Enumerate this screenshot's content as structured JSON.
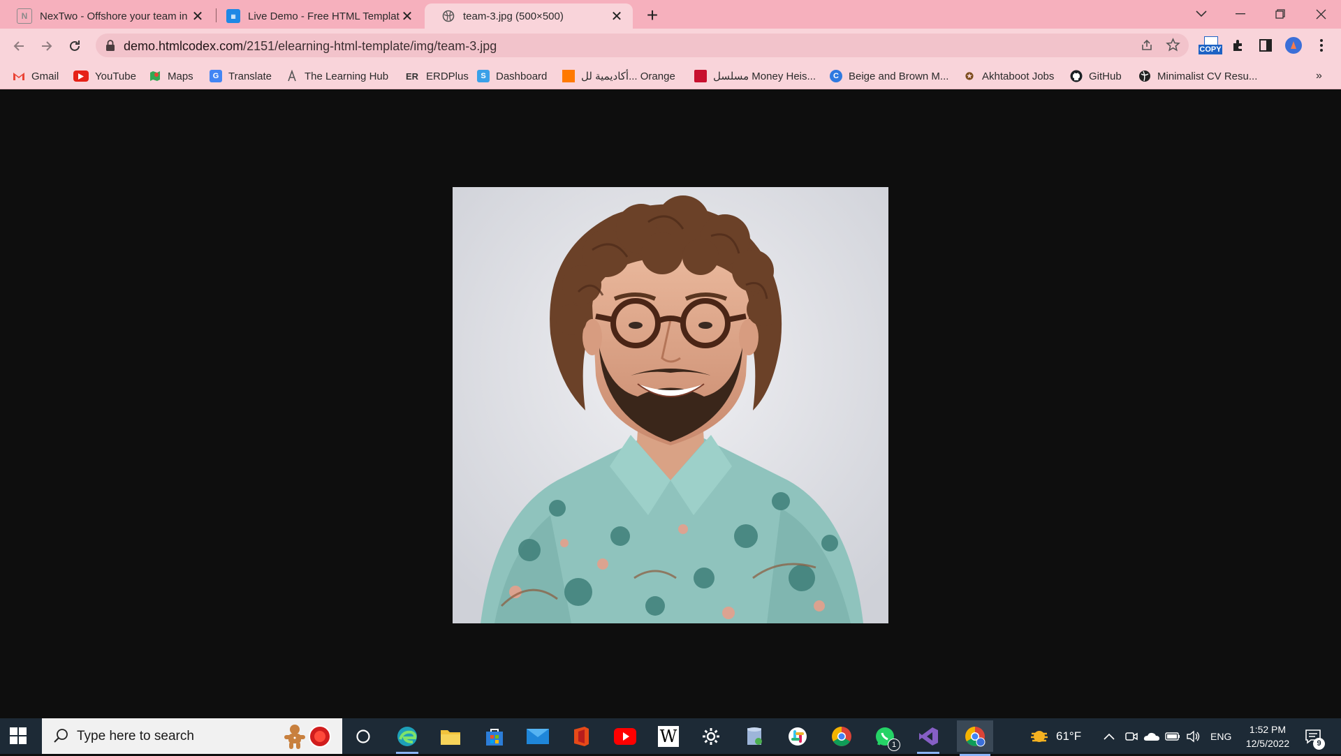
{
  "browser": {
    "tabs": [
      {
        "title": "NexTwo - Offshore your team in",
        "favicon": "nextwo-icon"
      },
      {
        "title": "Live Demo - Free HTML Template",
        "favicon": "htmlcodex-icon"
      },
      {
        "title": "team-3.jpg (500×500)",
        "favicon": "globe-icon",
        "active": true
      }
    ],
    "new_tab_label": "+",
    "window_controls": {
      "list": "⌄",
      "minimize": "—",
      "restore": "❐",
      "close": "✕"
    }
  },
  "toolbar": {
    "back": "←",
    "forward": "→",
    "reload": "↻",
    "url_host": "demo.htmlcodex.com",
    "url_path": "/2151/elearning-html-template/img/team-3.jpg",
    "copy_extension_label": "COPY"
  },
  "bookmarks": [
    {
      "label": "Gmail",
      "icon": "gmail-icon"
    },
    {
      "label": "YouTube",
      "icon": "youtube-icon"
    },
    {
      "label": "Maps",
      "icon": "maps-icon"
    },
    {
      "label": "Translate",
      "icon": "translate-icon"
    },
    {
      "label": "The Learning Hub",
      "icon": "learning-hub-icon"
    },
    {
      "label": "ERDPlus",
      "icon": "erdplus-icon"
    },
    {
      "label": "Dashboard",
      "icon": "dashboard-icon"
    },
    {
      "label": "أكاديمية لل... Orange",
      "icon": "orange-icon"
    },
    {
      "label": "مسلسل Money Heis...",
      "icon": "money-heist-icon"
    },
    {
      "label": "Beige and Brown M...",
      "icon": "canva-icon"
    },
    {
      "label": "Akhtaboot Jobs",
      "icon": "akhtaboot-icon"
    },
    {
      "label": "GitHub",
      "icon": "github-icon"
    },
    {
      "label": "Minimalist CV Resu...",
      "icon": "globe-icon"
    }
  ],
  "bookmarks_overflow": "»",
  "image_view": {
    "alt": "team-3.jpg"
  },
  "taskbar": {
    "search_placeholder": "Type here to search",
    "weather_temp": "61°F",
    "language": "ENG",
    "time": "1:52 PM",
    "date": "12/5/2022",
    "notifications_count": "9",
    "whatsapp_badge": "1"
  },
  "colors": {
    "tabstrip": "#f6b0bd",
    "toolbar": "#f9d4da",
    "page_background": "#0e0e0e",
    "taskbar": "#1d2a36"
  }
}
